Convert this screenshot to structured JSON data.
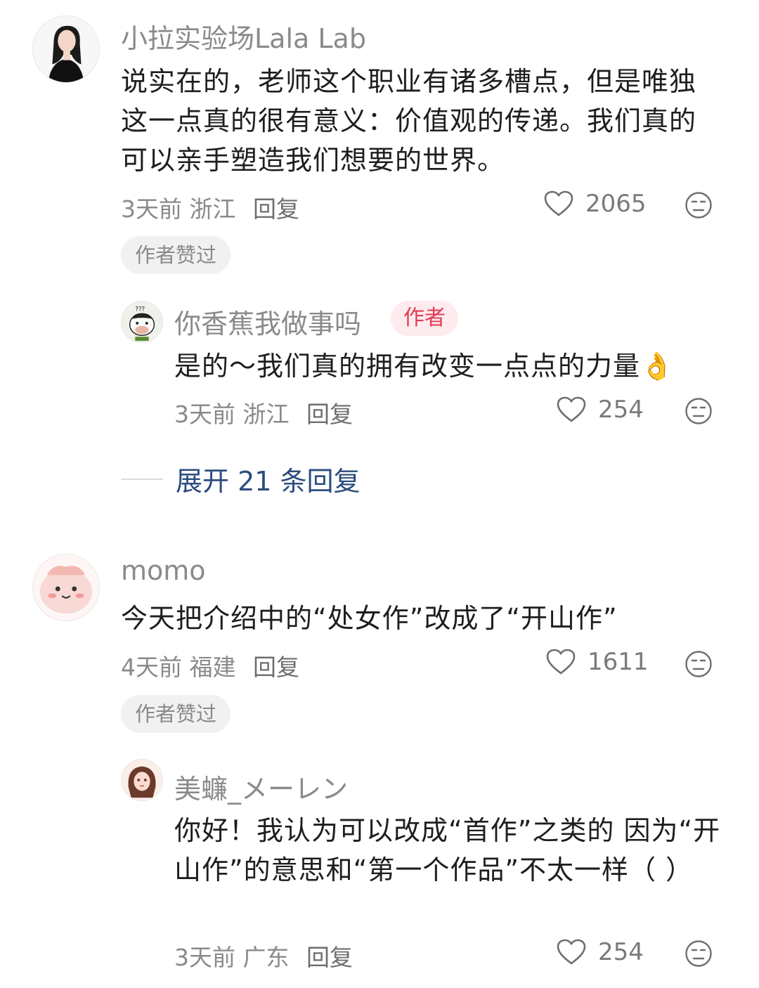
{
  "comments": [
    {
      "author": "小拉实验场Lala Lab",
      "text": "说实在的，老师这个职业有诸多槽点，但是唯独这一点真的很有意义：价值观的传递。我们真的可以亲手塑造我们想要的世界。",
      "time": "3天前",
      "location": "浙江",
      "reply_label": "回复",
      "likes": "2065",
      "badge": "作者赞过",
      "reply": {
        "author": "你香蕉我做事吗",
        "author_tag": "作者",
        "text": "是的～我们真的拥有改变一点点的力量👌",
        "time": "3天前",
        "location": "浙江",
        "reply_label": "回复",
        "likes": "254"
      },
      "expand_label": "展开 21 条回复"
    },
    {
      "author": "momo",
      "text": "今天把介绍中的“处女作”改成了“开山作”",
      "time": "4天前",
      "location": "福建",
      "reply_label": "回复",
      "likes": "1611",
      "badge": "作者赞过",
      "reply": {
        "author": "美蠊_メーレン",
        "text": "你好！我认为可以改成“首作”之类的 因为“开山作”的意思和“第一个作品”不太一样（ ）",
        "time": "3天前",
        "location": "广东",
        "reply_label": "回复",
        "likes": "254"
      }
    }
  ],
  "colors": {
    "author_tag_bg": "#fdebee",
    "author_tag_text": "#e33a52",
    "link": "#2b4c7e"
  }
}
